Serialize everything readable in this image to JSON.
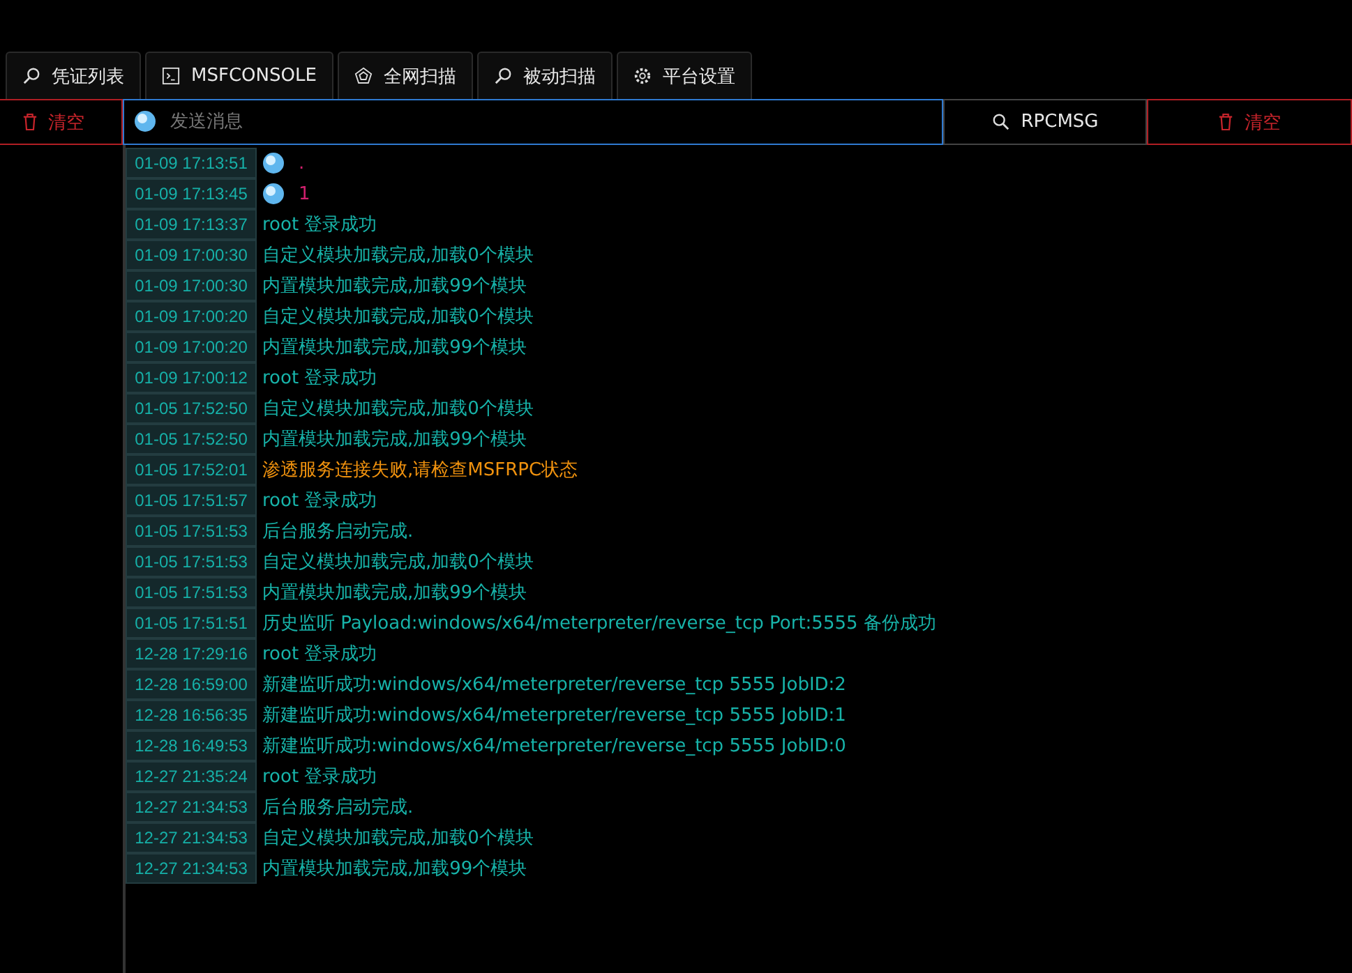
{
  "tabs": [
    {
      "label": "凭证列表"
    },
    {
      "label": "MSFCONSOLE"
    },
    {
      "label": "全网扫描"
    },
    {
      "label": "被动扫描"
    },
    {
      "label": "平台设置"
    }
  ],
  "left_clear_button": "清空",
  "message_input": {
    "placeholder": "发送消息"
  },
  "rpcmsg_button": "RPCMSG",
  "right_clear_button": "清空",
  "log": [
    {
      "time": "01-09 17:13:51",
      "kind": "user",
      "text": "."
    },
    {
      "time": "01-09 17:13:45",
      "kind": "user",
      "text": "1"
    },
    {
      "time": "01-09 17:13:37",
      "kind": "info",
      "text": "root 登录成功"
    },
    {
      "time": "01-09 17:00:30",
      "kind": "info",
      "text": "自定义模块加载完成,加载0个模块"
    },
    {
      "time": "01-09 17:00:30",
      "kind": "info",
      "text": "内置模块加载完成,加载99个模块"
    },
    {
      "time": "01-09 17:00:20",
      "kind": "info",
      "text": "自定义模块加载完成,加载0个模块"
    },
    {
      "time": "01-09 17:00:20",
      "kind": "info",
      "text": "内置模块加载完成,加载99个模块"
    },
    {
      "time": "01-09 17:00:12",
      "kind": "info",
      "text": "root 登录成功"
    },
    {
      "time": "01-05 17:52:50",
      "kind": "info",
      "text": "自定义模块加载完成,加载0个模块"
    },
    {
      "time": "01-05 17:52:50",
      "kind": "info",
      "text": "内置模块加载完成,加载99个模块"
    },
    {
      "time": "01-05 17:52:01",
      "kind": "error",
      "text": "渗透服务连接失败,请检查MSFRPC状态"
    },
    {
      "time": "01-05 17:51:57",
      "kind": "info",
      "text": "root 登录成功"
    },
    {
      "time": "01-05 17:51:53",
      "kind": "info",
      "text": "后台服务启动完成."
    },
    {
      "time": "01-05 17:51:53",
      "kind": "info",
      "text": "自定义模块加载完成,加载0个模块"
    },
    {
      "time": "01-05 17:51:53",
      "kind": "info",
      "text": "内置模块加载完成,加载99个模块"
    },
    {
      "time": "01-05 17:51:51",
      "kind": "info",
      "text": "历史监听 Payload:windows/x64/meterpreter/reverse_tcp Port:5555 备份成功"
    },
    {
      "time": "12-28 17:29:16",
      "kind": "info",
      "text": "root 登录成功"
    },
    {
      "time": "12-28 16:59:00",
      "kind": "info",
      "text": "新建监听成功:windows/x64/meterpreter/reverse_tcp 5555 JobID:2"
    },
    {
      "time": "12-28 16:56:35",
      "kind": "info",
      "text": "新建监听成功:windows/x64/meterpreter/reverse_tcp 5555 JobID:1"
    },
    {
      "time": "12-28 16:49:53",
      "kind": "info",
      "text": "新建监听成功:windows/x64/meterpreter/reverse_tcp 5555 JobID:0"
    },
    {
      "time": "12-27 21:35:24",
      "kind": "info",
      "text": "root 登录成功"
    },
    {
      "time": "12-27 21:34:53",
      "kind": "info",
      "text": "后台服务启动完成."
    },
    {
      "time": "12-27 21:34:53",
      "kind": "info",
      "text": "自定义模块加载完成,加载0个模块"
    },
    {
      "time": "12-27 21:34:53",
      "kind": "info",
      "text": "内置模块加载完成,加载99个模块"
    }
  ]
}
